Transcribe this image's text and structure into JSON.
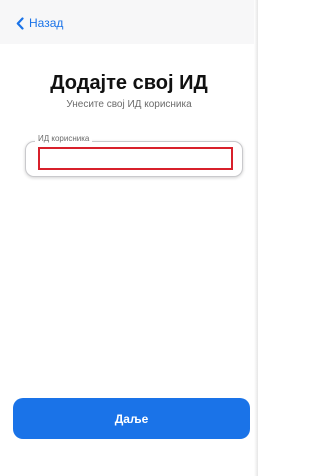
{
  "nav": {
    "back_label": "Назад",
    "back_icon": "chevron-left-icon"
  },
  "header": {
    "title": "Додајте свој ИД",
    "subtitle": "Унесите свој ИД корисника"
  },
  "form": {
    "user_id": {
      "label": "ИД корисника",
      "value": ""
    }
  },
  "footer": {
    "next_label": "Даље"
  },
  "colors": {
    "accent": "#1a73e8",
    "highlight_border": "#d8202b",
    "nav_background": "#f7f7f8"
  }
}
